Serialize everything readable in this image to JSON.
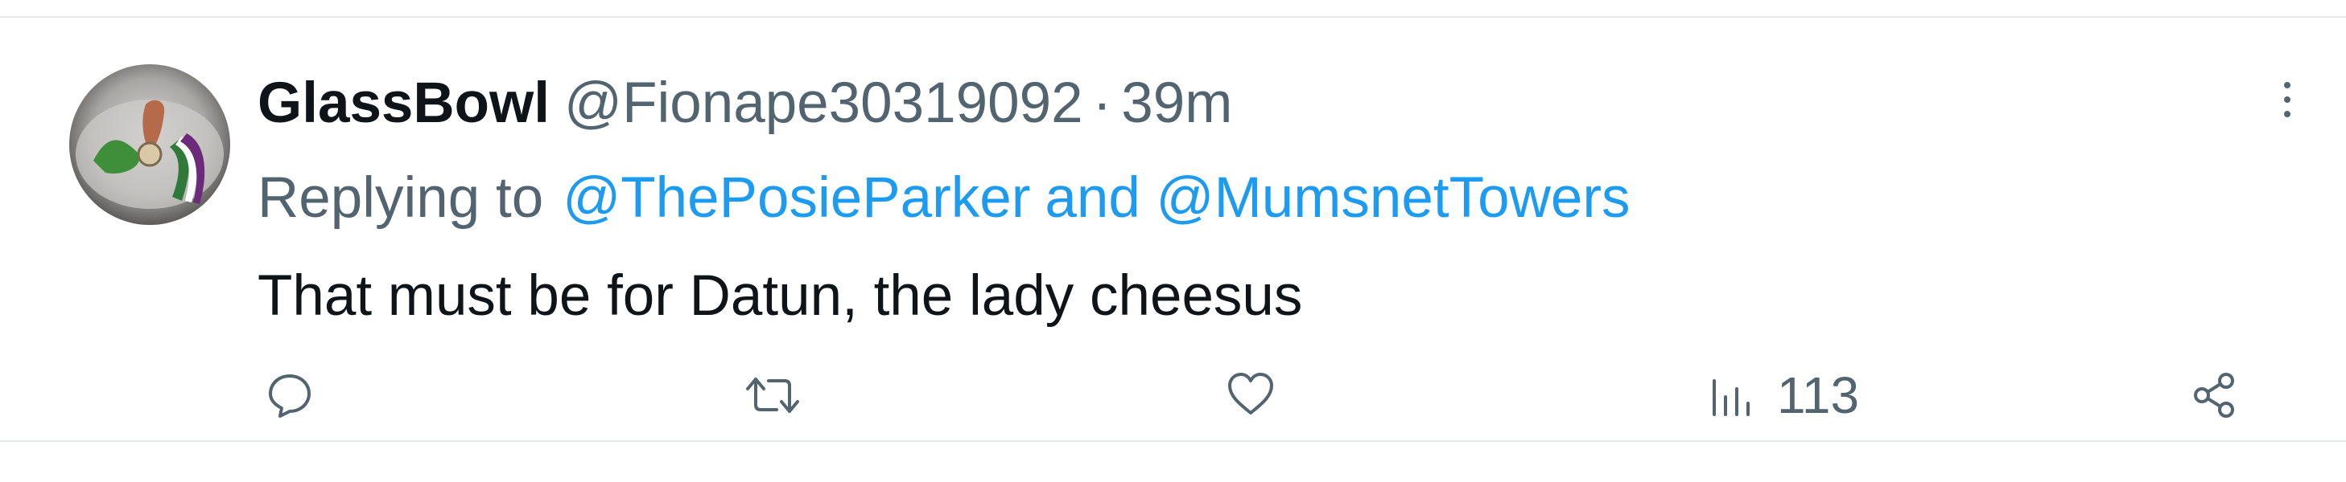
{
  "tweet": {
    "display_name": "GlassBowl",
    "handle": "@Fionape30319092",
    "separator": "·",
    "time": "39m",
    "reply_prefix": "Replying to",
    "reply_to_primary": "@ThePosieParker",
    "reply_to_secondary": "and @MumsnetTowers",
    "text": "That must be for Datun, the lady cheesus"
  },
  "actions": {
    "reply_icon": "reply-icon",
    "retweet_icon": "retweet-icon",
    "like_icon": "heart-icon",
    "views_icon": "views-icon",
    "views_count": "113",
    "share_icon": "share-icon",
    "more_icon": "more-icon"
  },
  "colors": {
    "text_primary": "#0f1419",
    "text_secondary": "#536471",
    "link": "#1d9bf0",
    "border": "#e6e9eb"
  }
}
